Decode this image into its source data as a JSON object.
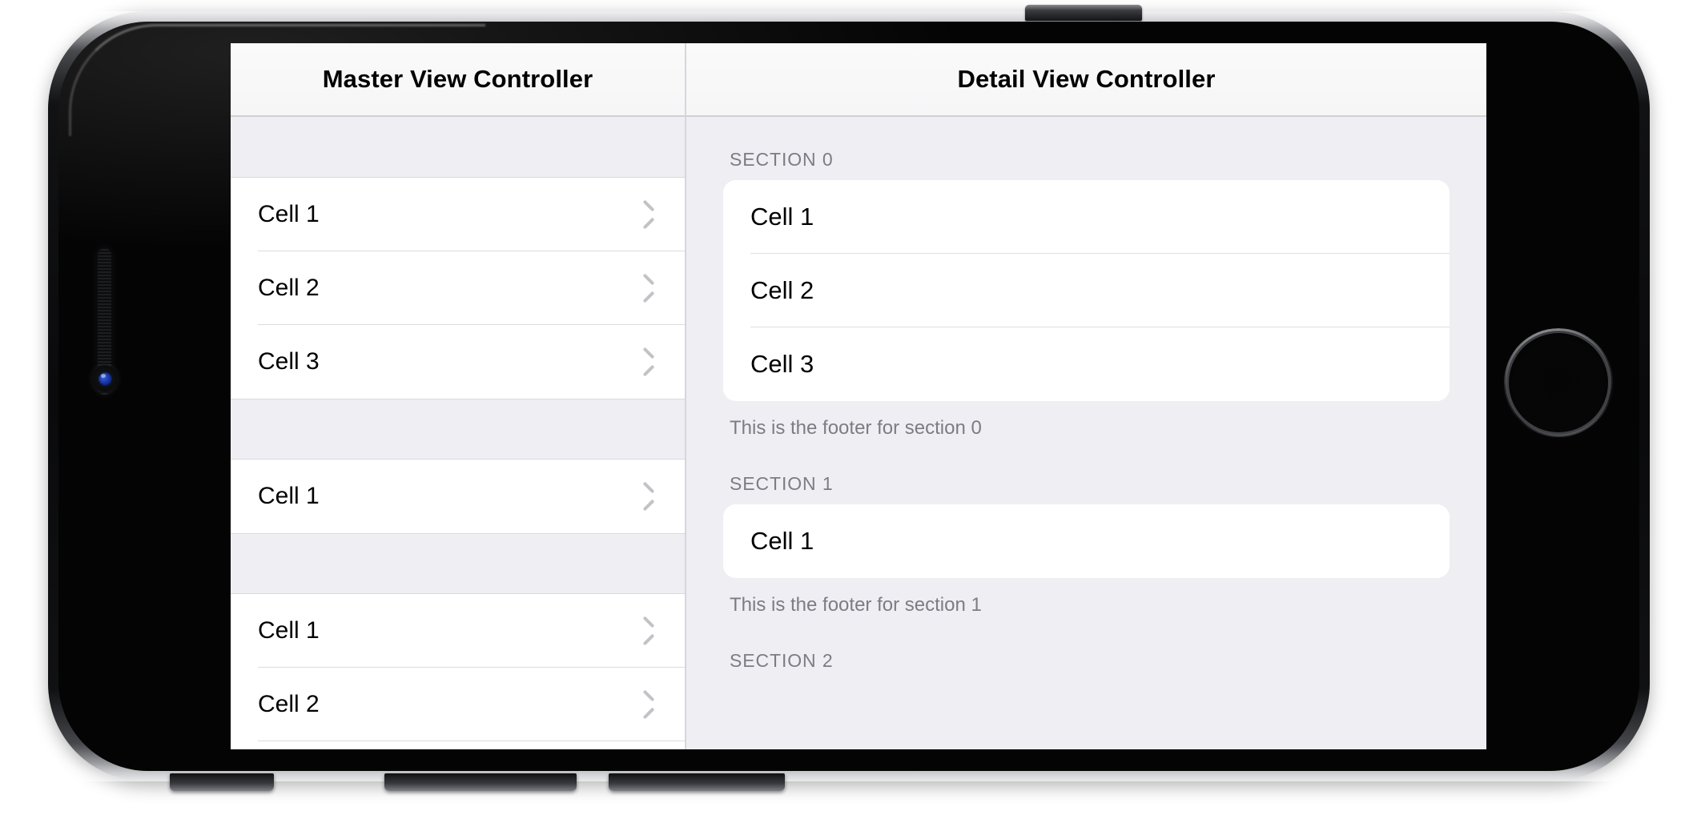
{
  "device": {
    "type": "iphone",
    "orientation": "landscape",
    "body_color": "#0a0a0c",
    "rim_color": "#9a9ba0",
    "elements": {
      "home_button": "home-button",
      "front_camera": "front-camera",
      "speaker": "earpiece-speaker",
      "power_button": "power-button",
      "volume_up_button": "volume-up-button",
      "volume_down_button": "volume-down-button",
      "ring_switch": "ring-silent-switch"
    }
  },
  "colors": {
    "screen_background": "#eeeef3",
    "cell_background": "#ffffff",
    "navbar_background": "#f8f8f9",
    "separator": "#dcdce1",
    "secondary_text": "#7c7c84",
    "chevron": "#c2c2c7"
  },
  "master": {
    "navbar": {
      "title": "Master View Controller"
    },
    "style": "plain",
    "sections": [
      {
        "header": "",
        "rows": [
          {
            "label": "Cell 1",
            "accessory": "chevron-right-icon"
          },
          {
            "label": "Cell 2",
            "accessory": "chevron-right-icon"
          },
          {
            "label": "Cell 3",
            "accessory": "chevron-right-icon"
          }
        ]
      },
      {
        "header": "",
        "rows": [
          {
            "label": "Cell 1",
            "accessory": "chevron-right-icon"
          }
        ]
      },
      {
        "header": "",
        "rows": [
          {
            "label": "Cell 1",
            "accessory": "chevron-right-icon"
          },
          {
            "label": "Cell 2",
            "accessory": "chevron-right-icon"
          }
        ]
      }
    ]
  },
  "detail": {
    "navbar": {
      "title": "Detail View Controller"
    },
    "style": "grouped",
    "sections": [
      {
        "header": "SECTION 0",
        "rows": [
          {
            "label": "Cell 1"
          },
          {
            "label": "Cell 2"
          },
          {
            "label": "Cell 3"
          }
        ],
        "footer": "This is the footer for section 0"
      },
      {
        "header": "SECTION 1",
        "rows": [
          {
            "label": "Cell 1"
          }
        ],
        "footer": "This is the footer for section 1"
      },
      {
        "header": "SECTION 2",
        "rows": [],
        "footer": ""
      }
    ]
  }
}
